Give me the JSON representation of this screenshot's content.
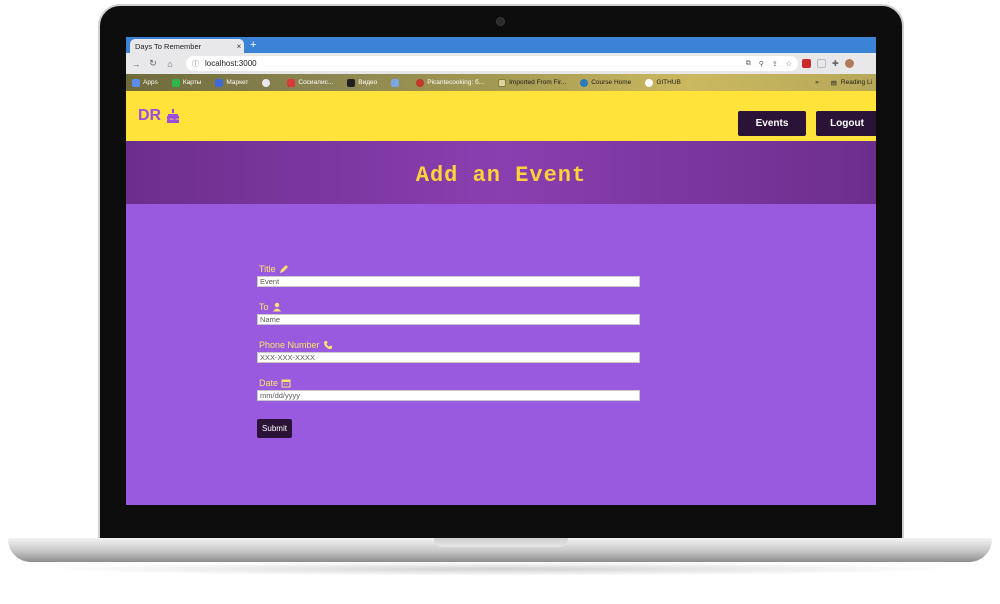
{
  "browser": {
    "tab_title": "Days To Remember",
    "tab_close": "×",
    "new_tab": "+",
    "url": "localhost:3000",
    "bookmarks": [
      {
        "label": "Apps",
        "dark": false
      },
      {
        "label": "Карты",
        "dark": false
      },
      {
        "label": "Маркет",
        "dark": false
      },
      {
        "label": "",
        "dark": false
      },
      {
        "label": "Сосиалис...",
        "dark": false
      },
      {
        "label": "Видео",
        "dark": false
      },
      {
        "label": "",
        "dark": false
      },
      {
        "label": "Picantecooking: б...",
        "dark": false
      },
      {
        "label": "Imported From Fir...",
        "dark": true
      },
      {
        "label": "Course Home",
        "dark": true
      },
      {
        "label": "GITHUB",
        "dark": true
      }
    ],
    "bookmarks_more": "»",
    "reading_list": "Reading Li"
  },
  "app": {
    "logo_text": "DR",
    "nav": {
      "events": "Events",
      "logout": "Logout"
    },
    "hero_title": "Add an Event",
    "form": {
      "title_label": "Title",
      "title_value": "Event",
      "to_label": "To",
      "to_value": "Name",
      "phone_label": "Phone Number",
      "phone_value": "XXX-XXX-XXXX",
      "date_label": "Date",
      "date_value": "mm/dd/yyyy",
      "submit_label": "Submit"
    }
  },
  "colors": {
    "navbar": "#ffe33a",
    "hero": "#7a35a0",
    "page": "#9a5ae0",
    "button": "#2a1337",
    "label": "#ffe36a",
    "logo": "#9b4fe0"
  }
}
